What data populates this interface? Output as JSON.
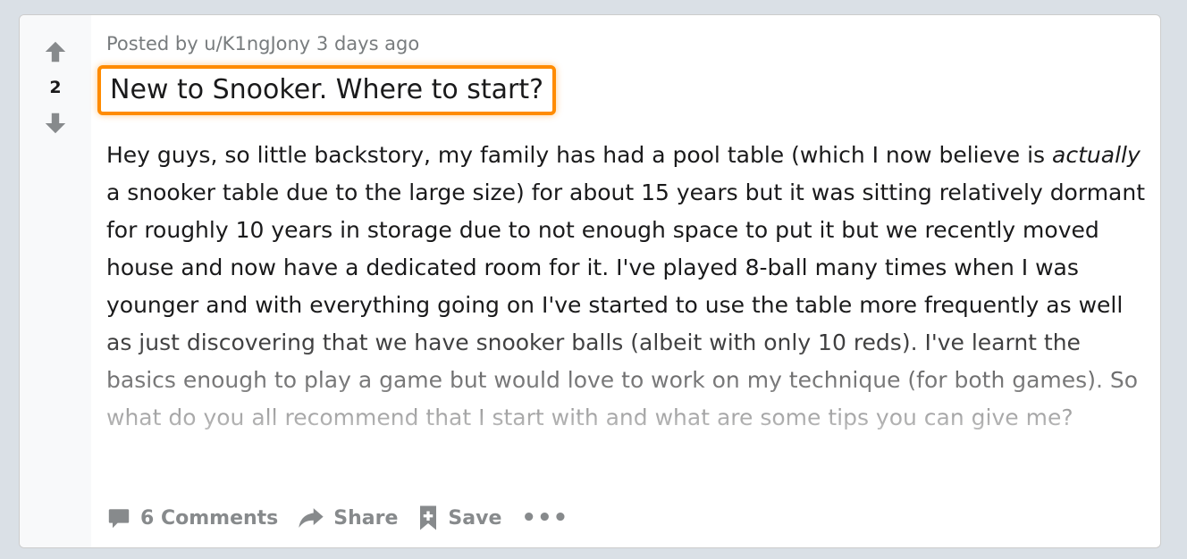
{
  "post": {
    "meta": "Posted by u/K1ngJony 3 days ago",
    "score": "2",
    "title": "New to Snooker. Where to start?",
    "body": {
      "part1": "Hey guys, so little backstory, my family has had a pool table (which I now believe is ",
      "italic": "actually",
      "part2": " a snooker table due to the large size) for about 15 years but it was sitting relatively dormant for roughly 10 years in storage due to not enough space to put it but we recently moved house and now have a dedicated room for it. I've played 8-ball many times when I was younger and with everything going on I've started to use the table more frequently as well as just discovering that we have snooker balls (albeit with only 10 reds). I've learnt the basics enough to play a game but would love to work on my technique (for both games). So what do you all recommend that I start with and what are some tips you can give me?"
    },
    "actions": {
      "comments": "6 Comments",
      "share": "Share",
      "save": "Save",
      "more": "•••"
    }
  },
  "icons": {
    "upvote": "arrow-up-icon",
    "downvote": "arrow-down-icon",
    "comments": "comment-icon",
    "share": "share-icon",
    "save": "bookmark-plus-icon",
    "more": "more-dots-icon"
  },
  "colors": {
    "highlight": "#ff8b00",
    "page_background": "#dae0e6",
    "muted": "#878a8c"
  }
}
